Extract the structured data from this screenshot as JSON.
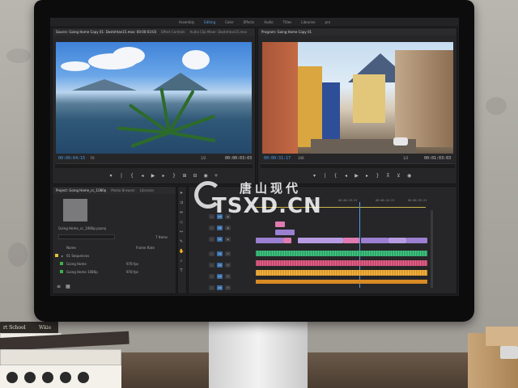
{
  "workspaces": [
    "Assembly",
    "Editing",
    "Color",
    "Effects",
    "Audio",
    "Titles",
    "Libraries",
    "pro"
  ],
  "active_workspace": "Editing",
  "source_monitor": {
    "tabs": [
      "Source: Going Home Copy 01: Dostehtan15.mov: 00:00:03:03",
      "Effect Controls",
      "Audio Clip Mixer: Dostehtan15.mov"
    ],
    "timecode_in": "00:00:04:15",
    "fit": "Fit",
    "scale": "1/2",
    "timecode_out": "00:00:03:03"
  },
  "program_monitor": {
    "tabs": [
      "Program: Going Home Copy 01"
    ],
    "timecode_in": "00:00:31:17",
    "fit": "106",
    "scale": "1/2",
    "timecode_out": "00:01:03:03"
  },
  "project_panel": {
    "tabs": [
      "Project: Going Home_cc_1080p",
      "Media Browser",
      "Libraries"
    ],
    "file_name": "Going Home_cc_1080p.prproj",
    "item_count": "7 Items",
    "col_name": "Name",
    "col_rate": "Frame Rate",
    "items": [
      {
        "name": "01 Sequences",
        "rate": "",
        "color": "#e0c33a"
      },
      {
        "name": "Going Home",
        "rate": "978 fps",
        "color": "#3fb04a"
      },
      {
        "name": "Going Home 1080p",
        "rate": "978 fps",
        "color": "#3fb04a"
      }
    ]
  },
  "timeline": {
    "ruler": [
      "00:00",
      "00:00:29:23",
      "00:00:44:23",
      "00:00:59:23"
    ],
    "track_labels": [
      "V3",
      "V2",
      "V1",
      "A1",
      "A2",
      "A3",
      "A4"
    ]
  },
  "watermark": {
    "chinese": "唐山现代",
    "latin": "TSXD.CN"
  },
  "book_spines": [
    "rt School",
    "Wkie"
  ],
  "colors": {
    "accent_blue": "#4f9de6",
    "clip_violet": "#9b7fd1",
    "clip_pink": "#e07ab0",
    "audio_green": "#2fa66a",
    "audio_rose": "#c8486f",
    "audio_orange": "#e09a2a"
  }
}
